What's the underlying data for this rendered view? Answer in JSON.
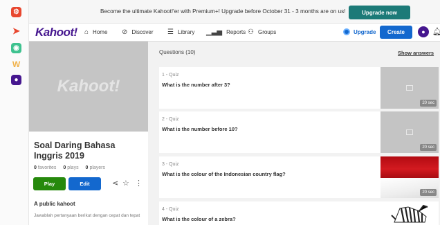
{
  "banner": {
    "text": "Become the ultimate Kahoot!'er with Premium+! Upgrade before October 31 - 3 months are on us!",
    "button": "Upgrade now"
  },
  "nav": {
    "logo": "Kahoot!",
    "items": [
      {
        "label": "Home",
        "icon": "home-icon"
      },
      {
        "label": "Discover",
        "icon": "compass-icon"
      },
      {
        "label": "Library",
        "icon": "list-icon"
      },
      {
        "label": "Reports",
        "icon": "chart-icon"
      },
      {
        "label": "Groups",
        "icon": "people-icon"
      }
    ],
    "upgrade": "Upgrade",
    "create": "Create"
  },
  "kahoot": {
    "cover_logo": "Kahoot!",
    "title": "Soal Daring Bahasa Inggris 2019",
    "favorites_count": "0",
    "favorites_label": "favorites",
    "plays_count": "0",
    "plays_label": "plays",
    "players_count": "0",
    "players_label": "players",
    "play_label": "Play",
    "edit_label": "Edit",
    "visibility": "A public kahoot",
    "description": "Jawablah pertanyaan berikut dengan cepat dan tepat"
  },
  "questions": {
    "header": "Questions (10)",
    "show_answers": "Show answers",
    "items": [
      {
        "type": "1 - Quiz",
        "text": "What is the number after 3?",
        "time": "20 sec"
      },
      {
        "type": "2 - Quiz",
        "text": "What is the number before 10?",
        "time": "20 sec"
      },
      {
        "type": "3 - Quiz",
        "text": "What is the colour of the Indonesian country flag?",
        "time": "20 sec"
      },
      {
        "type": "4 - Quiz",
        "text": "What is the colour of a zebra?",
        "time": ""
      }
    ]
  },
  "colors": {
    "brand": "#46178f",
    "play": "#26890c",
    "primary": "#1368ce",
    "banner_button": "#1c7a78"
  }
}
